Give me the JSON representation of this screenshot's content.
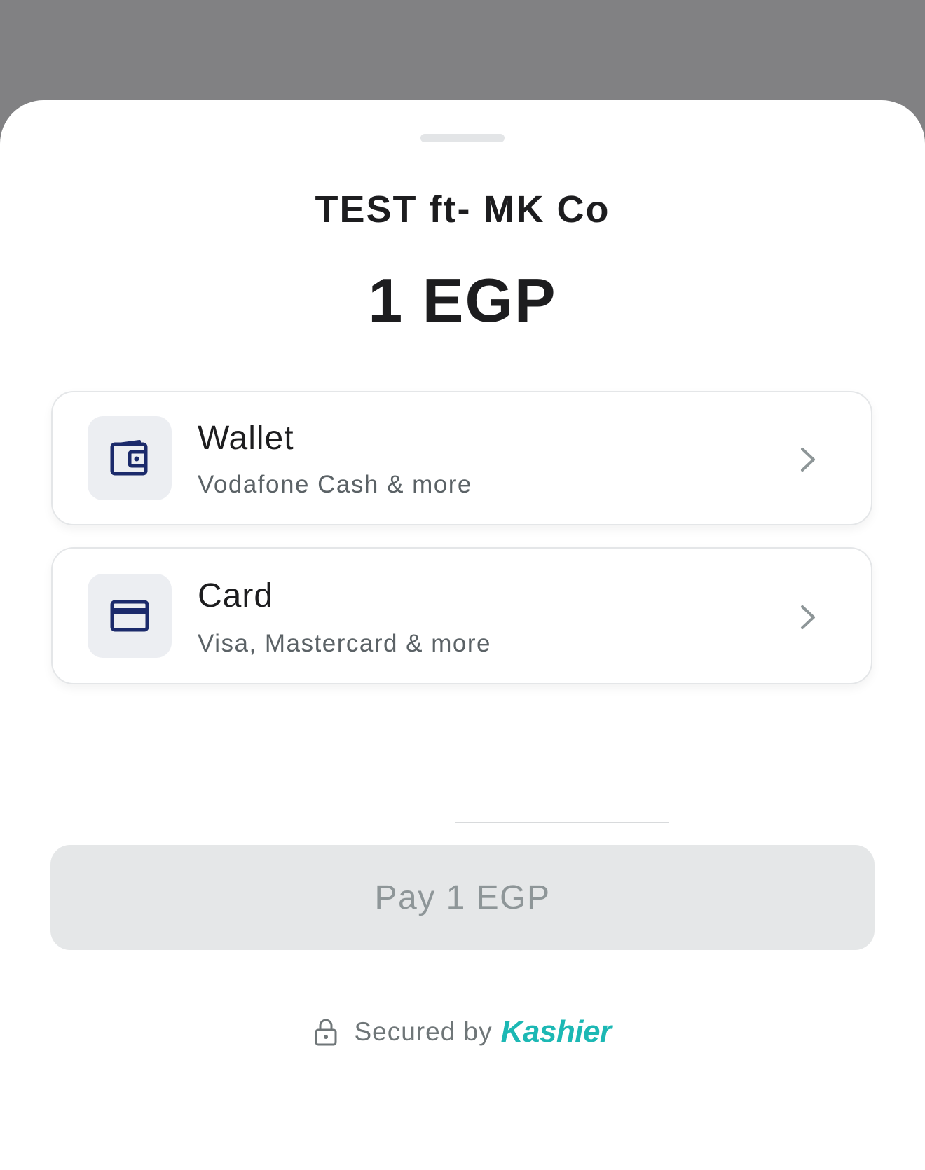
{
  "merchant": {
    "name": "TEST ft- MK Co"
  },
  "amount": {
    "display": "1 EGP"
  },
  "methods": [
    {
      "title": "Wallet",
      "subtitle": "Vodafone Cash & more",
      "icon": "wallet-icon"
    },
    {
      "title": "Card",
      "subtitle": "Visa, Mastercard & more",
      "icon": "credit-card-icon"
    }
  ],
  "pay_button": {
    "label": "Pay 1 EGP"
  },
  "footer": {
    "secured_label": "Secured by",
    "brand": "Kashier",
    "icon": "lock-icon"
  },
  "colors": {
    "overlay": "#818183",
    "icon_navy": "#1b2a6b",
    "brand_teal": "#1cb8b4",
    "button_disabled_bg": "#e5e7e8",
    "button_disabled_text": "#8e9698"
  }
}
